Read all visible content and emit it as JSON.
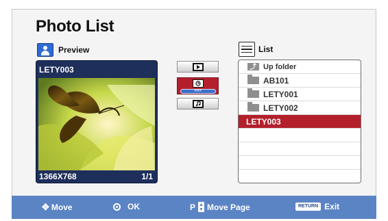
{
  "title": "Photo List",
  "preview": {
    "header_label": "Preview",
    "filename": "LETY003",
    "resolution": "1366X768",
    "page": "1/1"
  },
  "mode_buttons": [
    {
      "name": "slideshow",
      "icon": "play-icon"
    },
    {
      "name": "interval",
      "icon": "clock-icon",
      "active": true,
      "speed_label": ">>>"
    },
    {
      "name": "music",
      "icon": "music-note-icon"
    }
  ],
  "list": {
    "header_label": "List",
    "items": [
      {
        "label": "Up folder",
        "icon": "up-folder-icon"
      },
      {
        "label": "AB101",
        "icon": "folder-icon"
      },
      {
        "label": "LETY001",
        "icon": "folder-icon"
      },
      {
        "label": "LETY002",
        "icon": "folder-icon"
      },
      {
        "label": "LETY003",
        "selected": true
      }
    ]
  },
  "footer": {
    "move": "Move",
    "ok": "OK",
    "page_key": "P",
    "move_page": "Move Page",
    "return_key": "RETURN",
    "exit": "Exit"
  },
  "colors": {
    "accent_red": "#b3202c",
    "bar_blue": "#5b84c4",
    "preview_navy": "#1f2f5b"
  }
}
